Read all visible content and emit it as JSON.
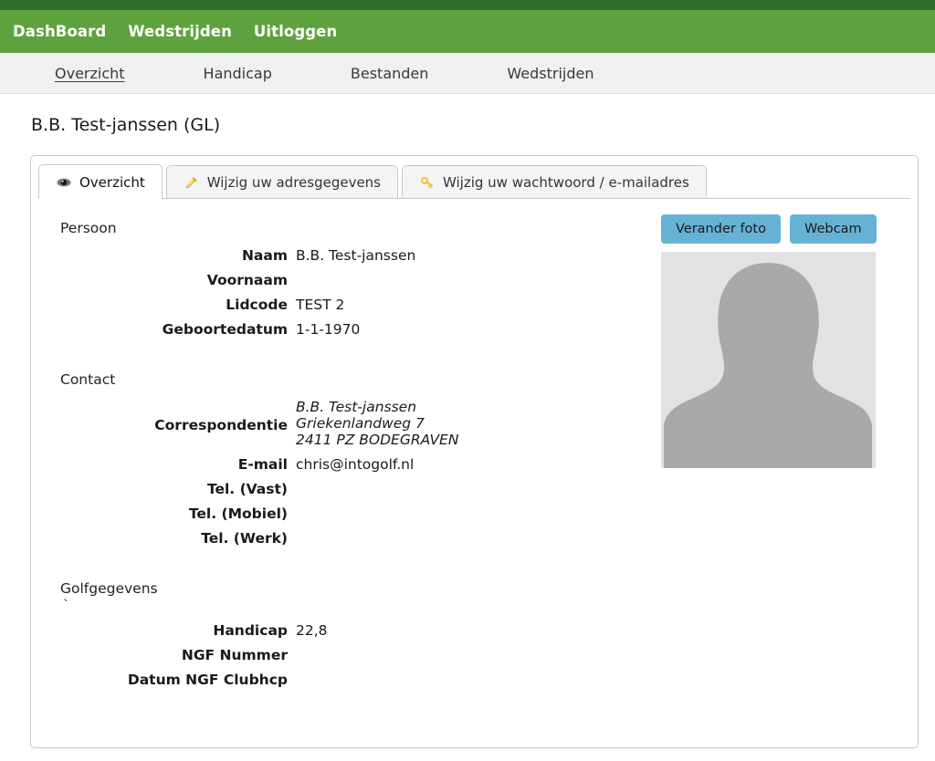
{
  "theme": {
    "navbar_green": "#5ea23e",
    "navbar_dark_green": "#2f6d2f",
    "subnav_gray": "#f0f0f0",
    "button_blue": "#66b2d6",
    "avatar_bg": "#e2e2e2",
    "avatar_fg": "#a9a9a9"
  },
  "navbar": {
    "links": [
      {
        "label": "DashBoard",
        "name": "nav-dashboard"
      },
      {
        "label": "Wedstrijden",
        "name": "nav-wedstrijden"
      },
      {
        "label": "Uitloggen",
        "name": "nav-uitloggen"
      }
    ]
  },
  "subnav": {
    "links": [
      {
        "label": "Overzicht",
        "active": true
      },
      {
        "label": "Handicap",
        "active": false
      },
      {
        "label": "Bestanden",
        "active": false
      },
      {
        "label": "Wedstrijden",
        "active": false
      }
    ]
  },
  "page": {
    "title": "B.B. Test-janssen (GL)"
  },
  "tabs": [
    {
      "label": "Overzicht",
      "icon": "eye-icon",
      "active": true
    },
    {
      "label": "Wijzig uw adresgegevens",
      "icon": "pencil-icon",
      "active": false
    },
    {
      "label": "Wijzig uw wachtwoord / e-mailadres",
      "icon": "key-icon",
      "active": false
    }
  ],
  "sections": {
    "persoon": {
      "title": "Persoon",
      "fields": [
        {
          "label": "Naam",
          "value": "B.B. Test-janssen",
          "italic": false
        },
        {
          "label": "Voornaam",
          "value": "",
          "italic": false
        },
        {
          "label": "Lidcode",
          "value": "TEST 2",
          "italic": false
        },
        {
          "label": "Geboortedatum",
          "value": "1-1-1970",
          "italic": false
        }
      ]
    },
    "contact": {
      "title": "Contact",
      "correspondentie_label": "Correspondentie",
      "correspondentie_value": "B.B. Test-janssen\nGriekenlandweg 7\n2411 PZ BODEGRAVEN",
      "fields": [
        {
          "label": "E-mail",
          "value": "chris@intogolf.nl",
          "italic": false
        },
        {
          "label": "Tel. (Vast)",
          "value": "",
          "italic": false
        },
        {
          "label": "Tel. (Mobiel)",
          "value": "",
          "italic": false
        },
        {
          "label": "Tel. (Werk)",
          "value": "",
          "italic": false
        }
      ]
    },
    "golfgegevens": {
      "title": "Golfgegevens",
      "stray_mark": "`",
      "fields": [
        {
          "label": "Handicap",
          "value": "22,8",
          "italic": false
        },
        {
          "label": "NGF Nummer",
          "value": "",
          "italic": false
        },
        {
          "label": "Datum NGF Clubhcp",
          "value": "",
          "italic": false
        }
      ]
    }
  },
  "photo": {
    "change_button": "Verander foto",
    "webcam_button": "Webcam",
    "placeholder_name": "avatar-placeholder"
  }
}
